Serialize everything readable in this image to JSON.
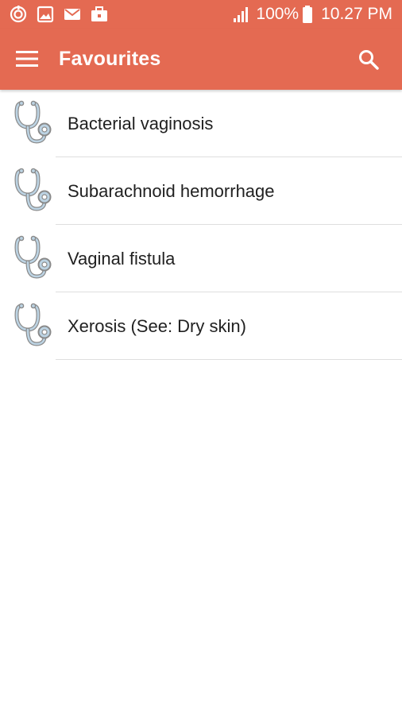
{
  "status_bar": {
    "left_icons": [
      "sync-icon",
      "image-icon",
      "mail-icon",
      "briefcase-icon"
    ],
    "battery": "100%",
    "time": "10.27 PM"
  },
  "app_bar": {
    "title": "Favourites",
    "menu_icon": "hamburger-menu-icon",
    "search_icon": "search-icon"
  },
  "favourites": [
    {
      "label": "Bacterial vaginosis",
      "icon": "stethoscope-icon"
    },
    {
      "label": "Subarachnoid hemorrhage",
      "icon": "stethoscope-icon"
    },
    {
      "label": "Vaginal fistula",
      "icon": "stethoscope-icon"
    },
    {
      "label": "Xerosis (See: Dry skin)",
      "icon": "stethoscope-icon"
    }
  ],
  "colors": {
    "accent": "#e46a52",
    "icon_tint": "#8fb3cc"
  }
}
